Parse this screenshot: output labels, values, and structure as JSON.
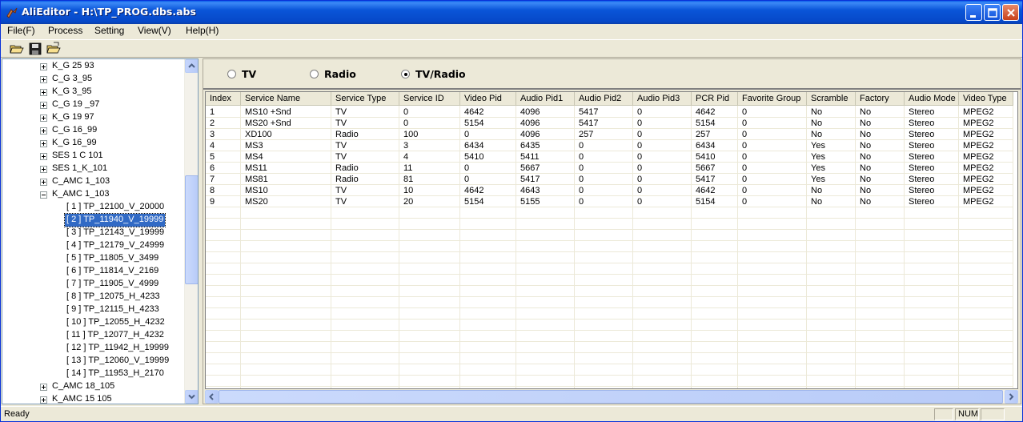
{
  "window": {
    "title": "AliEditor - H:\\TP_PROG.dbs.abs"
  },
  "menu": [
    "File(F)",
    "Process",
    "Setting",
    "View(V)",
    "Help(H)"
  ],
  "tree": {
    "top_nodes": [
      "K_G 25 93",
      "C_G 3_95",
      "K_G 3_95",
      "C_G 19 _97",
      "K_G 19  97",
      "C_G 16_99",
      "K_G 16_99",
      "SES 1 C 101",
      "SES 1_K_101",
      "C_AMC 1_103",
      "K_AMC 1_103"
    ],
    "children": [
      "[ 1 ]  TP_12100_V_20000",
      "[ 2 ]  TP_11940_V_19999",
      "[ 3 ]  TP_12143_V_19999",
      "[ 4 ]  TP_12179_V_24999",
      "[ 5 ]  TP_11805_V_3499",
      "[ 6 ]  TP_11814_V_2169",
      "[ 7 ]  TP_11905_V_4999",
      "[ 8 ]  TP_12075_H_4233",
      "[ 9 ]  TP_12115_H_4233",
      "[ 10 ]  TP_12055_H_4232",
      "[ 11 ]  TP_12077_H_4232",
      "[ 12 ]  TP_11942_H_19999",
      "[ 13 ]  TP_12060_V_19999",
      "[ 14 ]  TP_11953_H_2170"
    ],
    "bottom_nodes": [
      "C_AMC 18_105",
      "K_AMC 15 105"
    ],
    "selected_child": 1
  },
  "filter": {
    "options": [
      "TV",
      "Radio",
      "TV/Radio"
    ],
    "selected": 2
  },
  "table": {
    "columns": [
      "Index",
      "Service Name",
      "Service Type",
      "Service ID",
      "Video Pid",
      "Audio Pid1",
      "Audio Pid2",
      "Audio Pid3",
      "PCR Pid",
      "Favorite Group",
      "Scramble",
      "Factory",
      "Audio Mode",
      "Video Type"
    ],
    "rows": [
      [
        "1",
        "MS10 +Snd",
        "TV",
        "0",
        "4642",
        "4096",
        "5417",
        "0",
        "4642",
        "0",
        "No",
        "No",
        "Stereo",
        "MPEG2"
      ],
      [
        "2",
        "MS20 +Snd",
        "TV",
        "0",
        "5154",
        "4096",
        "5417",
        "0",
        "5154",
        "0",
        "No",
        "No",
        "Stereo",
        "MPEG2"
      ],
      [
        "3",
        "XD100",
        "Radio",
        "100",
        "0",
        "4096",
        "257",
        "0",
        "257",
        "0",
        "No",
        "No",
        "Stereo",
        "MPEG2"
      ],
      [
        "4",
        "MS3",
        "TV",
        "3",
        "6434",
        "6435",
        "0",
        "0",
        "6434",
        "0",
        "Yes",
        "No",
        "Stereo",
        "MPEG2"
      ],
      [
        "5",
        "MS4",
        "TV",
        "4",
        "5410",
        "5411",
        "0",
        "0",
        "5410",
        "0",
        "Yes",
        "No",
        "Stereo",
        "MPEG2"
      ],
      [
        "6",
        "MS11",
        "Radio",
        "11",
        "0",
        "5667",
        "0",
        "0",
        "5667",
        "0",
        "Yes",
        "No",
        "Stereo",
        "MPEG2"
      ],
      [
        "7",
        "MS81",
        "Radio",
        "81",
        "0",
        "5417",
        "0",
        "0",
        "5417",
        "0",
        "Yes",
        "No",
        "Stereo",
        "MPEG2"
      ],
      [
        "8",
        "MS10",
        "TV",
        "10",
        "4642",
        "4643",
        "0",
        "0",
        "4642",
        "0",
        "No",
        "No",
        "Stereo",
        "MPEG2"
      ],
      [
        "9",
        "MS20",
        "TV",
        "20",
        "5154",
        "5155",
        "0",
        "0",
        "5154",
        "0",
        "No",
        "No",
        "Stereo",
        "MPEG2"
      ]
    ]
  },
  "status": {
    "text": "Ready",
    "num": "NUM"
  },
  "colors": {
    "title_blue": "#0a55d8",
    "selection": "#316ac5",
    "face": "#ece9d8"
  },
  "icons": [
    "app-icon",
    "open-folder-icon",
    "save-icon",
    "open-file-icon",
    "minimize-icon",
    "maximize-icon",
    "close-icon",
    "scroll-up-icon",
    "scroll-down-icon",
    "scroll-left-icon",
    "scroll-right-icon",
    "expand-plus-icon",
    "collapse-minus-icon"
  ]
}
